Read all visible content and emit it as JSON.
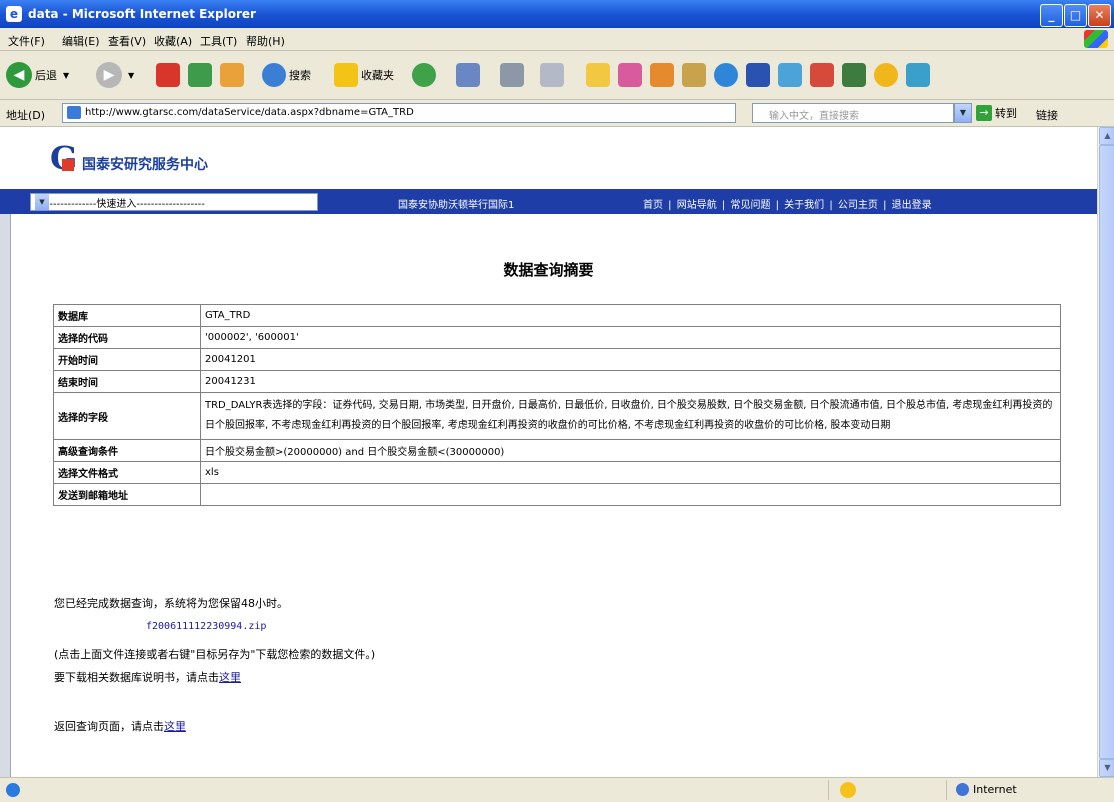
{
  "window": {
    "title": "data - Microsoft Internet Explorer"
  },
  "menu": [
    "文件(F)",
    "编辑(E)",
    "查看(V)",
    "收藏(A)",
    "工具(T)",
    "帮助(H)"
  ],
  "toolbar": {
    "back_label": "后退",
    "search_label": "搜索",
    "favorites_label": "收藏夹"
  },
  "address": {
    "label": "地址(D)",
    "url": "http://www.gtarsc.com/dataService/data.aspx?dbname=GTA_TRD",
    "search_placeholder": "输入中文，直接搜索",
    "go_label": "转到",
    "links_label": "链接"
  },
  "page": {
    "logo_text": "国泰安研究服务中心",
    "quick_select": "-----------------快速进入-------------------",
    "promo": "国泰安协助沃顿举行国际1",
    "nav_links": "首页 | 网站导航 | 常见问题 | 关于我们 | 公司主页 | 退出登录",
    "heading": "数据查询摘要",
    "rows": [
      {
        "key": "数据库",
        "value": "GTA_TRD"
      },
      {
        "key": "选择的代码",
        "value": "'000002', '600001'"
      },
      {
        "key": "开始时间",
        "value": "20041201"
      },
      {
        "key": "结束时间",
        "value": "20041231"
      },
      {
        "key": "选择的字段",
        "value": "TRD_DALYR表选择的字段：证券代码, 交易日期, 市场类型, 日开盘价, 日最高价, 日最低价, 日收盘价, 日个股交易股数, 日个股交易金额, 日个股流通市值, 日个股总市值, 考虑现金红利再投资的日个股回报率, 不考虑现金红利再投资的日个股回报率, 考虑现金红利再投资的收盘价的可比价格, 不考虑现金红利再投资的收盘价的可比价格, 股本变动日期"
      },
      {
        "key": "高级查询条件",
        "value": "日个股交易金额>(20000000) and 日个股交易金额<(30000000)"
      },
      {
        "key": "选择文件格式",
        "value": "xls"
      },
      {
        "key": "发送到邮箱地址",
        "value": ""
      }
    ],
    "done_msg": "您已经完成数据查询，系统将为您保留48小时。",
    "zip_file": "f2006111122309​94.zip",
    "hint": "(点击上面文件连接或者右键\"目标另存为\"下载您检索的数据文件。)",
    "doc_prefix": "要下载相关数据库说明书，请点击",
    "back_prefix": "返回查询页面，请点击",
    "here_link": "这里"
  },
  "status": {
    "zone": "Internet"
  }
}
